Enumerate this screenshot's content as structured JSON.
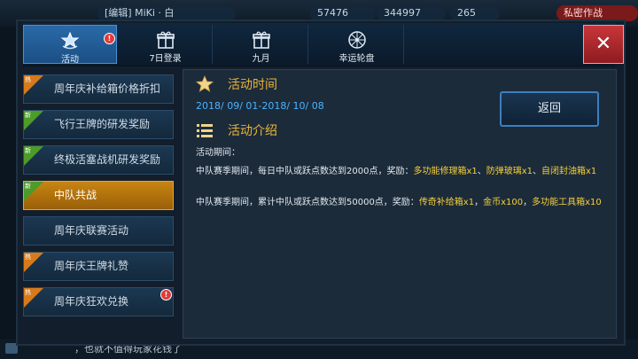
{
  "hud": {
    "player_name": "[编辑] MiKi · 白",
    "stat_1": "57476",
    "stat_2": "344997",
    "stat_3": "265",
    "right_button": "私密作战"
  },
  "bottom_bar": {
    "chat_text": "，也就不值得玩家花钱了"
  },
  "tabs": [
    {
      "label": "活动",
      "icon": "star-badge-icon"
    },
    {
      "label": "7日登录",
      "icon": "gift-icon"
    },
    {
      "label": "九月",
      "icon": "gift-icon"
    },
    {
      "label": "幸运轮盘",
      "icon": "wheel-icon"
    }
  ],
  "close_label": "✕",
  "badge_mark": "!",
  "sidebar": {
    "items": [
      {
        "label": "周年庆补给箱价格折扣",
        "tag": "热"
      },
      {
        "label": "飞行王牌的研发奖励",
        "tag": "新"
      },
      {
        "label": "终极活塞战机研发奖励",
        "tag": "新"
      },
      {
        "label": "中队共战",
        "tag": "新"
      },
      {
        "label": "周年庆联赛活动",
        "tag": ""
      },
      {
        "label": "周年庆王牌礼赞",
        "tag": "热"
      },
      {
        "label": "周年庆狂欢兑换",
        "tag": "热"
      }
    ]
  },
  "content": {
    "time_title": "活动时间",
    "date_range": "2018/ 09/ 01-2018/ 10/ 08",
    "intro_title": "活动介绍",
    "back_label": "返回",
    "period_label": "活动期间：",
    "para1_text": "中队赛季期间，每日中队或跃点数达到2000点，奖励：",
    "para1_reward1": "多功能修理箱x1",
    "para1_sep": "、",
    "para1_reward2": "防弹玻璃x1",
    "para1_reward3": "自闭封油箱x1",
    "para2_text": "中队赛季期间，累计中队或跃点数达到50000点，奖励：",
    "para2_reward1": "传奇补给箱x1",
    "para2_sep": "，",
    "para2_reward2": "金币x100",
    "para2_reward3": "多功能工具箱x10"
  },
  "colors": {
    "accent_gold": "#e9b43b",
    "date_blue": "#4ab3ff",
    "reward_yellow": "#f3cf3a",
    "active_orange": "#c88512",
    "close_red": "#c8363a"
  }
}
